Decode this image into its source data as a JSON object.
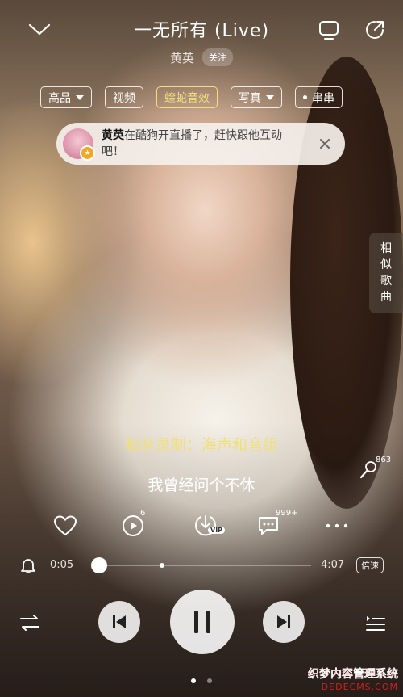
{
  "header": {
    "collapse_icon": "chevron-down-icon",
    "title": "一无所有 (Live)",
    "artist": "黄英",
    "follow_label": "关注",
    "tv_icon": "tv-icon",
    "share_icon": "share-icon"
  },
  "chips": {
    "quality": "高品",
    "video": "视频",
    "effect": "蝰蛇音效",
    "photo": "写真",
    "chuanchuan": "串串"
  },
  "notice": {
    "name": "黄英",
    "message": "在酷狗开直播了，赶快跟他互动吧！",
    "close_icon": "close-icon"
  },
  "side_tab": {
    "chars": [
      "相",
      "似",
      "歌",
      "曲"
    ]
  },
  "lyrics": {
    "current": "和音录制：海声和音组",
    "next": "我曾经问个不休"
  },
  "mic": {
    "icon": "microphone-icon",
    "count": "863"
  },
  "actions": {
    "like_icon": "heart-icon",
    "mv_icon": "video-icon",
    "mv_count": "6",
    "download_icon": "download-icon",
    "vip_badge": "VIP",
    "comment_icon": "comment-icon",
    "comment_count": "999+",
    "more_icon": "more-icon"
  },
  "player": {
    "alarm_icon": "bell-icon",
    "elapsed": "0:05",
    "duration": "4:07",
    "progress_fraction": 0.02,
    "speed_label": "倍速"
  },
  "controls": {
    "mode_icon": "shuffle-icon",
    "prev_icon": "previous-icon",
    "pause_icon": "pause-icon",
    "next_icon": "next-icon",
    "playlist_icon": "playlist-icon"
  },
  "pager": {
    "pages": 2,
    "active": 0
  },
  "watermark": {
    "line1": "织梦内容管理系统",
    "line2": "DEDECMS.COM"
  },
  "colors": {
    "highlight_lyric": "#f0e07a",
    "chip_gold": "#f0e07a"
  }
}
